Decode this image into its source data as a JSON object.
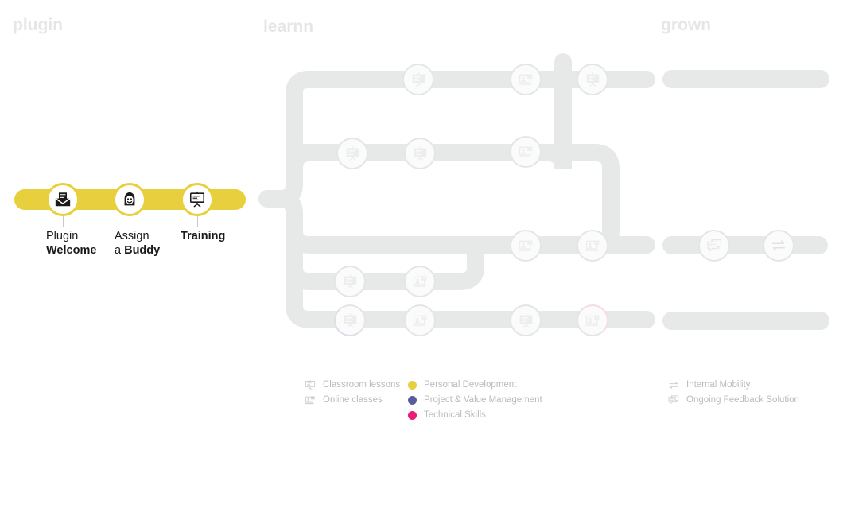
{
  "columns": {
    "plugin": {
      "title": "plugin"
    },
    "learn": {
      "title": "learnn"
    },
    "grow": {
      "title": "grown"
    }
  },
  "plugin": {
    "bar_color": "#e8cf3e",
    "steps": [
      {
        "icon": "mail-envelope-icon",
        "line1": "Plugin",
        "line2": "Welcome"
      },
      {
        "icon": "buddy-person-icon",
        "line1": "Assign",
        "line2_prefix": "a ",
        "line2": "Buddy"
      },
      {
        "icon": "presentation-board-icon",
        "line1": "",
        "line2": "Training"
      }
    ]
  },
  "learn": {
    "track_color": "#e7e9e8",
    "nodes": [
      {
        "icon": "presentation-board-icon",
        "type": "Classroom lessons"
      },
      {
        "icon": "online-class-icon",
        "type": "Online classes"
      },
      {
        "icon": "presentation-board-icon",
        "type": "Classroom lessons"
      },
      {
        "icon": "presentation-board-icon",
        "type": "Classroom lessons"
      },
      {
        "icon": "presentation-board-icon",
        "type": "Classroom lessons"
      },
      {
        "icon": "online-class-icon",
        "type": "Online classes"
      },
      {
        "icon": "online-class-icon",
        "type": "Online classes"
      },
      {
        "icon": "online-class-icon",
        "type": "Online classes"
      },
      {
        "icon": "presentation-board-icon",
        "type": "Classroom lessons"
      },
      {
        "icon": "online-class-icon",
        "type": "Online classes"
      },
      {
        "icon": "presentation-board-icon",
        "type": "Classroom lessons"
      },
      {
        "icon": "online-class-icon",
        "type": "Online classes"
      },
      {
        "icon": "presentation-board-icon",
        "type": "Classroom lessons"
      },
      {
        "icon": "online-class-icon",
        "type": "Online classes"
      }
    ]
  },
  "grow": {
    "track_color": "#e7e9e8",
    "nodes": [
      {
        "icon": "feedback-bubble-icon",
        "label": "Ongoing Feedback Solution"
      },
      {
        "icon": "mobility-arrows-icon",
        "label": "Internal Mobility"
      }
    ]
  },
  "legend": {
    "learn_types": [
      {
        "icon": "presentation-board-icon",
        "label": "Classroom lessons"
      },
      {
        "icon": "online-class-icon",
        "label": "Online classes"
      }
    ],
    "learn_categories": [
      {
        "color": "#e8cf3e",
        "label": "Personal Development"
      },
      {
        "color": "#5a5a9e",
        "label": "Project & Value Management"
      },
      {
        "color": "#ec1a78",
        "label": "Technical Skills"
      }
    ],
    "grow_items": [
      {
        "icon": "mobility-arrows-icon",
        "label": "Internal Mobility"
      },
      {
        "icon": "feedback-bubble-icon",
        "label": "Ongoing Feedback Solution"
      }
    ]
  }
}
